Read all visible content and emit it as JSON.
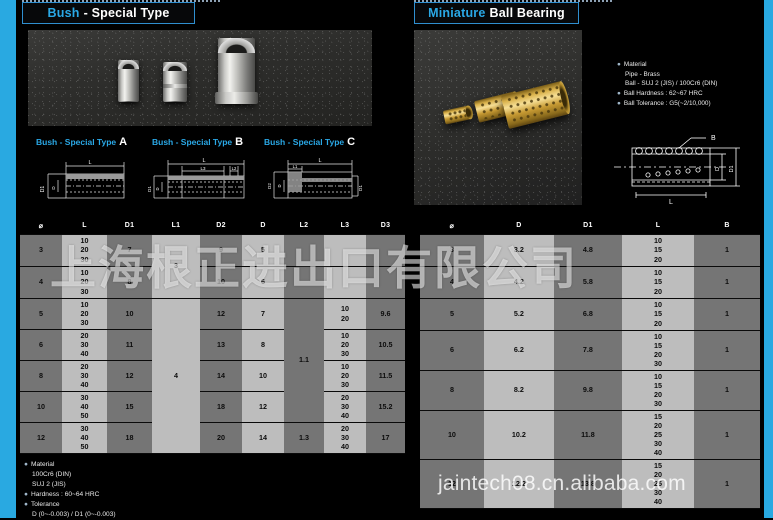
{
  "panels": {
    "left": {
      "title_accent": "Bush",
      "title_rest": "- Special Type"
    },
    "right": {
      "title_accent": "Miniature",
      "title_rest": "Ball Bearing"
    }
  },
  "bush_captions": [
    {
      "text": "Bush - Special Type",
      "letter": "A"
    },
    {
      "text": "Bush - Special Type",
      "letter": "B"
    },
    {
      "text": "Bush - Special Type",
      "letter": "C"
    }
  ],
  "drawing_labels": {
    "type_a": [
      "L",
      "D1",
      "D"
    ],
    "type_b": [
      "L",
      "L3",
      "L2",
      "D1",
      "D"
    ],
    "type_c": [
      "L",
      "L1",
      "D2",
      "D",
      "D1"
    ],
    "ball": [
      "B",
      "L",
      "D",
      "D1"
    ]
  },
  "specs_left": {
    "items": [
      {
        "bullet": true,
        "text": "Material"
      },
      {
        "bullet": false,
        "text": "100Cr6 (DIN)"
      },
      {
        "bullet": false,
        "text": "SUJ 2 (JIS)"
      },
      {
        "bullet": true,
        "text": "Hardness : 60~64 HRC"
      },
      {
        "bullet": true,
        "text": "Tolerance"
      },
      {
        "bullet": false,
        "text": "D (0~-0.003) / D1 (0~-0.003)"
      }
    ]
  },
  "specs_right": {
    "items": [
      {
        "bullet": true,
        "text": "Material"
      },
      {
        "bullet": false,
        "text": "Pipe - Brass"
      },
      {
        "bullet": false,
        "text": "Ball - SUJ 2 (JIS) / 100Cr6 (DIN)"
      },
      {
        "bullet": true,
        "text": "Ball Hardness : 62~67 HRC"
      },
      {
        "bullet": true,
        "text": "Ball Tolerance : G5(~2/10,000)"
      }
    ]
  },
  "table_left": {
    "headers": [
      "⌀",
      "L",
      "D1",
      "L1",
      "D2",
      "D",
      "L2",
      "L3",
      "D3"
    ],
    "rows": [
      {
        "dia": "3",
        "L": "10\n20\n30",
        "D1": "7",
        "D2": "9",
        "D": "5"
      },
      {
        "dia": "4",
        "L": "10\n20\n30",
        "D1": "8",
        "D2": "10",
        "D": "6"
      },
      {
        "dia": "5",
        "L": "10\n20\n30",
        "D1": "10",
        "D2": "12",
        "D": "7",
        "L3": "10\n20",
        "D3": "9.6"
      },
      {
        "dia": "6",
        "L": "20\n30\n40",
        "D1": "11",
        "D2": "13",
        "D": "8",
        "L3": "10\n20\n30",
        "D3": "10.5"
      },
      {
        "dia": "8",
        "L": "20\n30\n40",
        "D1": "12",
        "D2": "14",
        "D": "10",
        "L3": "10\n20\n30",
        "D3": "11.5"
      },
      {
        "dia": "10",
        "L": "30\n40\n50",
        "D1": "15",
        "D2": "18",
        "D": "12",
        "L3": "20\n30\n40",
        "D3": "15.2"
      },
      {
        "dia": "12",
        "L": "30\n40\n50",
        "D1": "18",
        "D2": "20",
        "D": "14",
        "L3": "20\n30\n40",
        "D3": "17"
      }
    ],
    "L1_group_top": "3",
    "L1_group_bottom": "4",
    "L2_group_top": "1.1",
    "L2_group_bottom": "1.3"
  },
  "table_right": {
    "headers": [
      "⌀",
      "D",
      "D1",
      "L",
      "B"
    ],
    "rows": [
      {
        "dia": "3",
        "D": "3.2",
        "D1": "4.8",
        "L": "10\n15\n20",
        "B": "1"
      },
      {
        "dia": "4",
        "D": "4.2",
        "D1": "5.8",
        "L": "10\n15\n20",
        "B": "1"
      },
      {
        "dia": "5",
        "D": "5.2",
        "D1": "6.8",
        "L": "10\n15\n20",
        "B": "1"
      },
      {
        "dia": "6",
        "D": "6.2",
        "D1": "7.8",
        "L": "10\n15\n20\n30",
        "B": "1"
      },
      {
        "dia": "8",
        "D": "8.2",
        "D1": "9.8",
        "L": "10\n15\n20\n30",
        "B": "1"
      },
      {
        "dia": "10",
        "D": "10.2",
        "D1": "11.8",
        "L": "15\n20\n25\n30\n40",
        "B": "1"
      },
      {
        "dia": "12",
        "D": "12.2",
        "D1": "13.8",
        "L": "15\n20\n25\n30\n40",
        "B": "1"
      }
    ]
  },
  "watermarks": {
    "chinese": "上海根正进出口有限公司",
    "url": "jaintech08.cn.alibaba.com"
  },
  "colors": {
    "accent": "#29a9e1",
    "background": "#000000",
    "cell_dark": "#757575",
    "cell_light": "#bdbdbd"
  }
}
